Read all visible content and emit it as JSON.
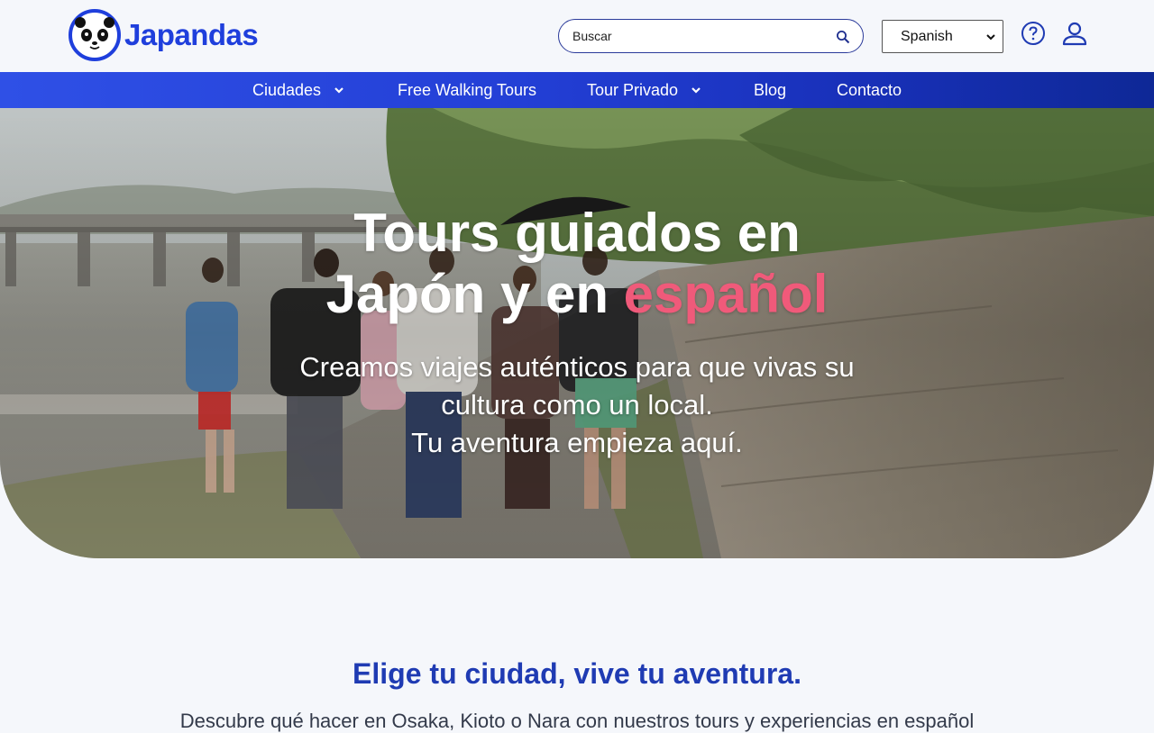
{
  "brand": {
    "name": "Japandas",
    "color": "#1f3fdc"
  },
  "header": {
    "search_placeholder": "Buscar",
    "language": "Spanish"
  },
  "nav": {
    "items": [
      {
        "label": "Ciudades",
        "dropdown": true
      },
      {
        "label": "Free Walking Tours",
        "dropdown": false
      },
      {
        "label": "Tour Privado",
        "dropdown": true
      },
      {
        "label": "Blog",
        "dropdown": false
      },
      {
        "label": "Contacto",
        "dropdown": false
      }
    ]
  },
  "hero": {
    "title_line1": "Tours guiados en",
    "title_line2_a": "Japón y en ",
    "title_line2_accent": "español",
    "subtitle_line1": "Creamos viajes auténticos para que vivas su",
    "subtitle_line2": "cultura como un local.",
    "subtitle_line3": "Tu aventura empieza aquí.",
    "accent_color": "#f05a7a"
  },
  "section": {
    "title_a": "Elige tu ciudad, ",
    "title_b": "vive tu aventura.",
    "description": "Descubre qué hacer en Osaka, Kioto o Nara con nuestros tours y experiencias en español"
  },
  "icons": {
    "search": "search-icon",
    "help": "help-icon",
    "user": "user-icon",
    "caret": "chevron-down-icon"
  }
}
